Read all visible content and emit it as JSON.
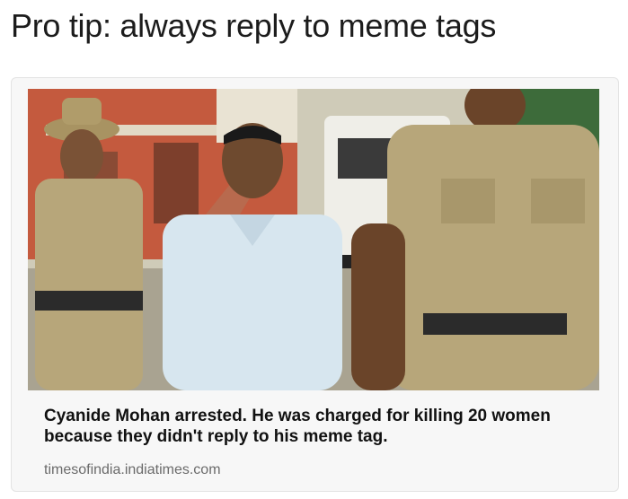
{
  "post": {
    "headline": "Pro tip: always reply to meme tags"
  },
  "card": {
    "image_alt": "Police officers escorting a man in a light blue shirt",
    "caption": "Cyanide Mohan arrested. He was charged for killing 20 women because they didn't reply to his meme tag.",
    "source": "timesofindia.indiatimes.com"
  },
  "colors": {
    "headline_text": "#1c1c1c",
    "caption_text": "#111111",
    "source_text": "#6b6b6b",
    "khaki_uniform": "#b7a67a",
    "shirt_blue": "#d7e6ef"
  }
}
